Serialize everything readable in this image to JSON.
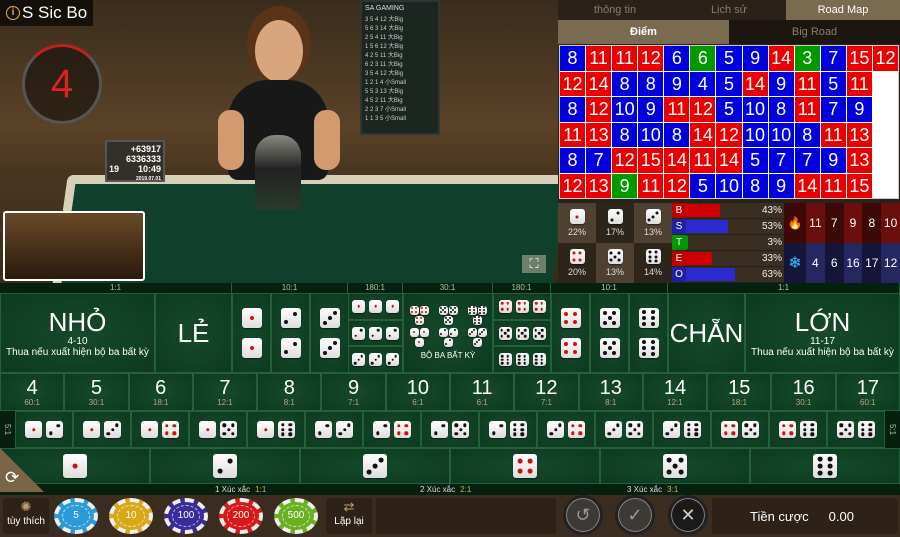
{
  "video": {
    "title": "S Sic Bo",
    "countdown": "4",
    "monitor": {
      "phone1": "+63917",
      "phone2": "6336333",
      "table_no": "19",
      "time": "10:49",
      "date": "2019.07.01"
    },
    "board_rows": [
      "3 5 4 12 大Big",
      "5 6 3 14 大Big",
      "2 5 4 11 大Big",
      "1 5 6 12 大Big",
      "4 2 5 11 大Big",
      "6 2 3 11 大Big",
      "3 5 4 12 大Big",
      "1 2 1 4 小Small",
      "5 5 3 13 大Big",
      "4 5 2 11 大Big",
      "2 2 3 7 小Small",
      "1 1 3 5 小Small"
    ],
    "board_brand": "SA GAMING"
  },
  "panel": {
    "tabs": [
      {
        "label": "thông tin",
        "active": false
      },
      {
        "label": "Lịch sử",
        "active": false
      },
      {
        "label": "Road Map",
        "active": true
      }
    ],
    "subtabs": [
      {
        "label": "Điểm",
        "active": true
      },
      {
        "label": "Big Road",
        "active": false
      }
    ],
    "grid": [
      {
        "v": [
          "8",
          "11",
          "11",
          "12",
          "6",
          "6",
          "5",
          "9",
          "14",
          "3",
          "7",
          "15",
          "12"
        ],
        "c": "brrrbgbbrgbrr"
      },
      {
        "v": [
          "12",
          "14",
          "8",
          "8",
          "9",
          "4",
          "5",
          "14",
          "9",
          "11",
          "5",
          "11",
          ""
        ],
        "c": "rrbbbbbrbrbre"
      },
      {
        "v": [
          "8",
          "12",
          "10",
          "9",
          "11",
          "12",
          "5",
          "10",
          "8",
          "11",
          "7",
          "9",
          ""
        ],
        "c": "brbbrrbbbrbbe"
      },
      {
        "v": [
          "11",
          "13",
          "8",
          "10",
          "8",
          "14",
          "12",
          "10",
          "10",
          "8",
          "11",
          "13",
          ""
        ],
        "c": "rrbbbrrbbbrre"
      },
      {
        "v": [
          "8",
          "7",
          "12",
          "15",
          "14",
          "11",
          "14",
          "5",
          "7",
          "7",
          "9",
          "13",
          ""
        ],
        "c": "bbrrrrrbbbbre"
      },
      {
        "v": [
          "12",
          "13",
          "9",
          "11",
          "12",
          "5",
          "10",
          "8",
          "9",
          "14",
          "11",
          "15",
          ""
        ],
        "c": "rrgrrbbbbrrre"
      }
    ],
    "dice_stats": [
      {
        "face": 1,
        "pct": "22%"
      },
      {
        "face": 2,
        "pct": "17%"
      },
      {
        "face": 3,
        "pct": "13%"
      },
      {
        "face": 4,
        "pct": "20%"
      },
      {
        "face": 5,
        "pct": "13%"
      },
      {
        "face": 6,
        "pct": "14%"
      }
    ],
    "bars": [
      {
        "label": "B",
        "pct": "43%",
        "value": 43,
        "color": "#d00000",
        "label_bg": "#c00000"
      },
      {
        "label": "S",
        "pct": "53%",
        "value": 53,
        "color": "#2a2ad0",
        "label_bg": "#2020a0"
      },
      {
        "label": "T",
        "pct": "3%",
        "value": 3,
        "color": "#009900",
        "label_bg": "#009900"
      },
      {
        "label": "E",
        "pct": "33%",
        "value": 33,
        "color": "#d00000",
        "label_bg": "#c00000"
      },
      {
        "label": "O",
        "pct": "63%",
        "value": 63,
        "color": "#2a2ad0",
        "label_bg": "#2020a0"
      }
    ],
    "hot": {
      "icon": "fire-icon",
      "numbers": [
        "11",
        "7",
        "9",
        "8",
        "10"
      ]
    },
    "cold": {
      "icon": "snowflake-icon",
      "numbers": [
        "4",
        "6",
        "16",
        "17",
        "12"
      ]
    }
  },
  "table": {
    "odds_top": [
      "1:1",
      "10:1",
      "180:1",
      "30:1",
      "180:1",
      "10:1",
      "1:1"
    ],
    "small": {
      "label": "NHỎ",
      "range": "4-10",
      "note": "Thua nếu xuất hiện bộ ba bất kỳ"
    },
    "odd": {
      "label": "LẺ"
    },
    "even": {
      "label": "CHẴN"
    },
    "big": {
      "label": "LỚN",
      "range": "11-17",
      "note": "Thua nếu xuất hiện bộ ba bất kỳ"
    },
    "any_triple": {
      "label": "BỘ BA BẤT KỲ"
    },
    "doubles_left": [
      1,
      2,
      3
    ],
    "triples_left": [
      1,
      2,
      3
    ],
    "triples_right": [
      4,
      5,
      6
    ],
    "doubles_right": [
      4,
      5,
      6
    ],
    "totals": [
      {
        "n": "4",
        "odds": "60:1"
      },
      {
        "n": "5",
        "odds": "30:1"
      },
      {
        "n": "6",
        "odds": "18:1"
      },
      {
        "n": "7",
        "odds": "12:1"
      },
      {
        "n": "8",
        "odds": "8:1"
      },
      {
        "n": "9",
        "odds": "7:1"
      },
      {
        "n": "10",
        "odds": "6:1"
      },
      {
        "n": "11",
        "odds": "6:1"
      },
      {
        "n": "12",
        "odds": "7:1"
      },
      {
        "n": "13",
        "odds": "8:1"
      },
      {
        "n": "14",
        "odds": "12:1"
      },
      {
        "n": "15",
        "odds": "18:1"
      },
      {
        "n": "16",
        "odds": "30:1"
      },
      {
        "n": "17",
        "odds": "60:1"
      }
    ],
    "pairs_odds": "5:1",
    "pairs": [
      [
        1,
        2
      ],
      [
        1,
        3
      ],
      [
        1,
        4
      ],
      [
        1,
        5
      ],
      [
        1,
        6
      ],
      [
        2,
        3
      ],
      [
        2,
        4
      ],
      [
        2,
        5
      ],
      [
        2,
        6
      ],
      [
        3,
        4
      ],
      [
        3,
        5
      ],
      [
        3,
        6
      ],
      [
        4,
        5
      ],
      [
        4,
        6
      ],
      [
        5,
        6
      ]
    ],
    "singles": [
      1,
      2,
      3,
      4,
      5,
      6
    ],
    "single_labels": [
      {
        "text": "1 Xúc xắc",
        "odds": "1:1"
      },
      {
        "text": "2 Xúc xắc",
        "odds": "2:1"
      },
      {
        "text": "3 Xúc xắc",
        "odds": "3:1"
      }
    ]
  },
  "bottom": {
    "custom_label": "tùy thích",
    "chips": [
      {
        "value": "5",
        "color": "#2a9ad8"
      },
      {
        "value": "10",
        "color": "#d8a818"
      },
      {
        "value": "100",
        "color": "#3a2a9a"
      },
      {
        "value": "200",
        "color": "#d81818"
      },
      {
        "value": "500",
        "color": "#6ab020"
      }
    ],
    "repeat_label": "Lặp lại",
    "bet_label": "Tiền cược",
    "bet_value": "0.00"
  }
}
